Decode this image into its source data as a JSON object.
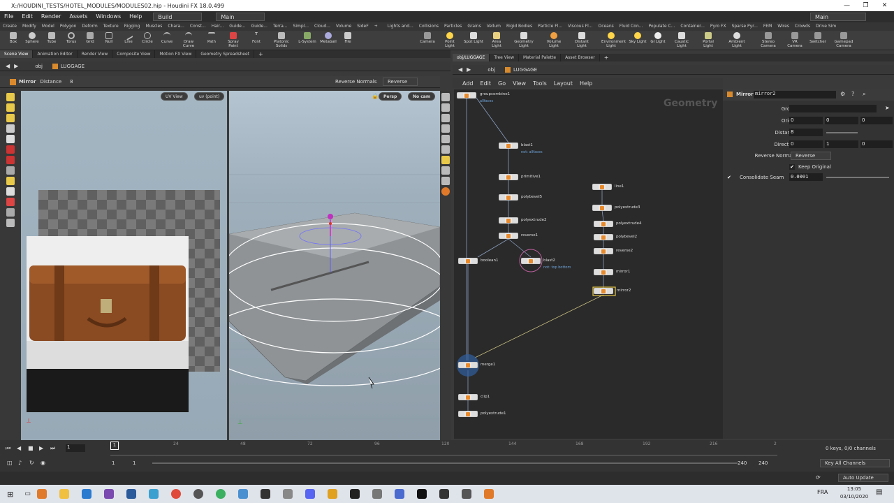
{
  "window": {
    "title": "X:/HOUDINI_TESTS/HOTEL_MODULES/MODULES02.hip - Houdini FX 18.0.499"
  },
  "menu": [
    "File",
    "Edit",
    "Render",
    "Assets",
    "Windows",
    "Help"
  ],
  "desktop_left": "Build",
  "desktop_right": "Main",
  "shelf_tabs_left": [
    "Create",
    "Modify",
    "Model",
    "Polygon",
    "Deform",
    "Texture",
    "Rigging",
    "Muscles",
    "Chara...",
    "Const...",
    "Hair...",
    "Guide...",
    "Guide...",
    "Terra...",
    "Simpl...",
    "Cloud...",
    "Volume",
    "SideF"
  ],
  "shelf_tabs_right": [
    "Lights and...",
    "Collisions",
    "Particles",
    "Grains",
    "Vellum",
    "Rigid Bodies",
    "Particle Fl...",
    "Viscous Fl...",
    "Oceans",
    "Fluid Con...",
    "Populate C...",
    "Container...",
    "Pyro FX",
    "Sparse Pyr...",
    "FEM",
    "Wires",
    "Crowds",
    "Drive Sim"
  ],
  "tools_left": [
    "Box",
    "Sphere",
    "Tube",
    "Torus",
    "Grid",
    "Null",
    "Line",
    "Circle",
    "Curve",
    "Draw Curve",
    "Path",
    "Spray Paint",
    "Font",
    "Platonic Solids",
    "L-System",
    "Metaball",
    "File"
  ],
  "tools_right": [
    "Camera",
    "Point Light",
    "Spot Light",
    "Area Light",
    "Geometry Light",
    "Volume Light",
    "Distant Light",
    "Environment Light",
    "Sky Light",
    "GI Light",
    "Caustic Light",
    "Portal Light",
    "Ambient Light",
    "Stereo Camera",
    "VR Camera",
    "Switcher",
    "Gamepad Camera"
  ],
  "left_tabs": [
    "Scene View",
    "Animation Editor",
    "Render View",
    "Composite View",
    "Motion FX View",
    "Geometry Spreadsheet"
  ],
  "right_tabs": [
    "obj/LUGGAGE",
    "Tree View",
    "Material Palette",
    "Asset Browser"
  ],
  "path": {
    "obj": "obj",
    "node": "LUGGAGE"
  },
  "op_bar": {
    "name": "Mirror",
    "distance_label": "Distance",
    "distance_value": "8",
    "reverse_label": "Reverse Normals",
    "reverse_value": "Reverse"
  },
  "uv_view": {
    "menu1": "UV View",
    "menu2": "uv (point)"
  },
  "view3d": {
    "persp": "Persp",
    "cam": "No cam"
  },
  "network_menu": [
    "Add",
    "Edit",
    "Go",
    "View",
    "Tools",
    "Layout",
    "Help"
  ],
  "network_context": "Geometry",
  "nodes": [
    {
      "name": "groupcombine1",
      "sub": "allfaces"
    },
    {
      "name": "blast1",
      "sub": "not: allfaces"
    },
    {
      "name": "primitive1",
      "sub": ""
    },
    {
      "name": "polybevel5",
      "sub": ""
    },
    {
      "name": "polyextrude2",
      "sub": ""
    },
    {
      "name": "reverse1",
      "sub": ""
    },
    {
      "name": "boolean1",
      "sub": ""
    },
    {
      "name": "blast2",
      "sub": "not: top bottom"
    },
    {
      "name": "line1",
      "sub": ""
    },
    {
      "name": "polyextrude3",
      "sub": ""
    },
    {
      "name": "polyextrude4",
      "sub": ""
    },
    {
      "name": "polybevel2",
      "sub": ""
    },
    {
      "name": "reverse2",
      "sub": ""
    },
    {
      "name": "mirror1",
      "sub": ""
    },
    {
      "name": "mirror2",
      "sub": ""
    },
    {
      "name": "merge1",
      "sub": ""
    },
    {
      "name": "clip1",
      "sub": ""
    },
    {
      "name": "polyextrude1",
      "sub": ""
    }
  ],
  "params": {
    "type": "Mirror",
    "name": "mirror2",
    "group_label": "Group",
    "origin_label": "Origin",
    "origin": [
      "0",
      "0",
      "0"
    ],
    "distance_label": "Distance",
    "distance": "8",
    "direction_label": "Direction",
    "direction": [
      "0",
      "1",
      "0"
    ],
    "reverse_label": "Reverse Normals",
    "reverse_value": "Reverse",
    "keep_label": "Keep Original",
    "seam_label": "Consolidate Seam",
    "seam_value": "0.0001"
  },
  "timeline": {
    "frame": "1",
    "ticks": [
      "1",
      "24",
      "48",
      "72",
      "96",
      "120",
      "144",
      "168",
      "192",
      "216",
      "2"
    ],
    "start": "1",
    "start2": "1",
    "end": "240",
    "end2": "240",
    "keys": "0 keys, 0/0 channels",
    "key_all": "Key All Channels",
    "auto": "Auto Update"
  },
  "taskbar": {
    "lang": "FRA",
    "time": "13:05",
    "date": "03/10/2020"
  }
}
